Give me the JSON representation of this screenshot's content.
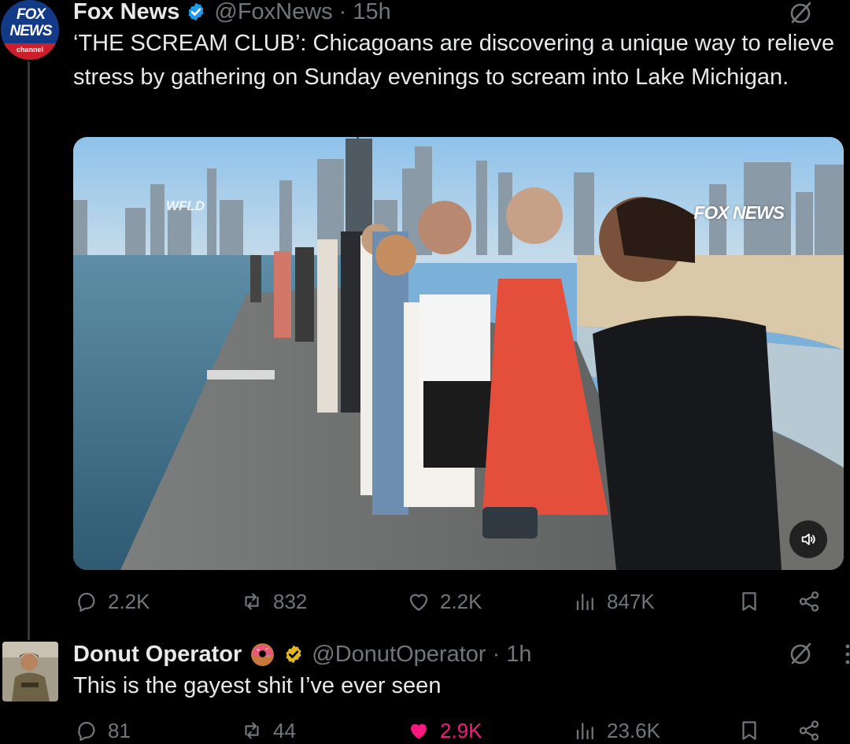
{
  "tweets": [
    {
      "author": {
        "name": "Fox News",
        "handle": "@FoxNews",
        "time": "· 15h",
        "avatar": {
          "word1": "FOX",
          "word2": "NEWS",
          "word3": "channel"
        }
      },
      "text": "‘THE SCREAM CLUB’: Chicagoans are discovering a unique way to relieve stress by gathering on Sunday evenings to scream into Lake Michigan.",
      "media": {
        "watermark": "FOX NEWS",
        "station_bug": "WFLD",
        "sound_icon": "speaker-icon"
      },
      "stats": {
        "replies": "2.2K",
        "reposts": "832",
        "likes": "2.2K",
        "views": "847K"
      }
    },
    {
      "author": {
        "name": "Donut Operator",
        "handle": "@DonutOperator",
        "time": "· 1h"
      },
      "text": "This is the gayest shit I’ve ever seen",
      "stats": {
        "replies": "81",
        "reposts": "44",
        "likes": "2.9K",
        "views": "23.6K",
        "liked": true
      }
    }
  ],
  "colors": {
    "background": "#000000",
    "text": "#e7e9ea",
    "muted": "#71767b",
    "verified_blue": "#1d9bf0",
    "verified_gold": "#e2b719",
    "like_pink": "#f91880"
  }
}
